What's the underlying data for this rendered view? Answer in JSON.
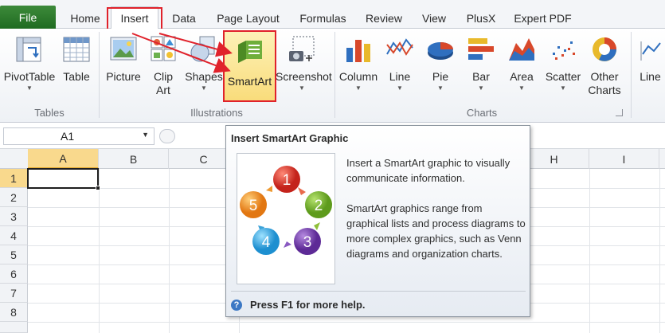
{
  "tabs": {
    "file": "File",
    "items": [
      "Home",
      "Insert",
      "Data",
      "Page Layout",
      "Formulas",
      "Review",
      "View",
      "PlusX",
      "Expert PDF"
    ],
    "active": "Insert"
  },
  "ribbon": {
    "tables_group": "Tables",
    "illustrations_group": "Illustrations",
    "charts_group": "Charts",
    "pivottable": "PivotTable",
    "table": "Table",
    "picture": "Picture",
    "clipart_1": "Clip",
    "clipart_2": "Art",
    "shapes": "Shapes",
    "smartart": "SmartArt",
    "screenshot": "Screenshot",
    "column": "Column",
    "line": "Line",
    "pie": "Pie",
    "bar": "Bar",
    "area": "Area",
    "scatter": "Scatter",
    "other_charts_1": "Other",
    "other_charts_2": "Charts",
    "line_sparkline": "Line"
  },
  "formula_bar": {
    "name_box": "A1"
  },
  "grid": {
    "columns": [
      "A",
      "B",
      "C",
      "H",
      "I"
    ],
    "rows": [
      "1",
      "2",
      "3",
      "4",
      "5",
      "6",
      "7",
      "8"
    ]
  },
  "tooltip": {
    "title": "Insert SmartArt Graphic",
    "desc1": "Insert a SmartArt graphic to visually communicate information.",
    "desc2": "SmartArt graphics range from graphical lists and process diagrams to more complex graphics, such as Venn diagrams and organization charts.",
    "help": "Press F1 for more help.",
    "cycle": [
      "1",
      "2",
      "3",
      "4",
      "5"
    ]
  },
  "colors": {
    "file_tab": "#2a7a2d",
    "highlight": "#e0222b",
    "selected_header": "#f9d98d"
  }
}
